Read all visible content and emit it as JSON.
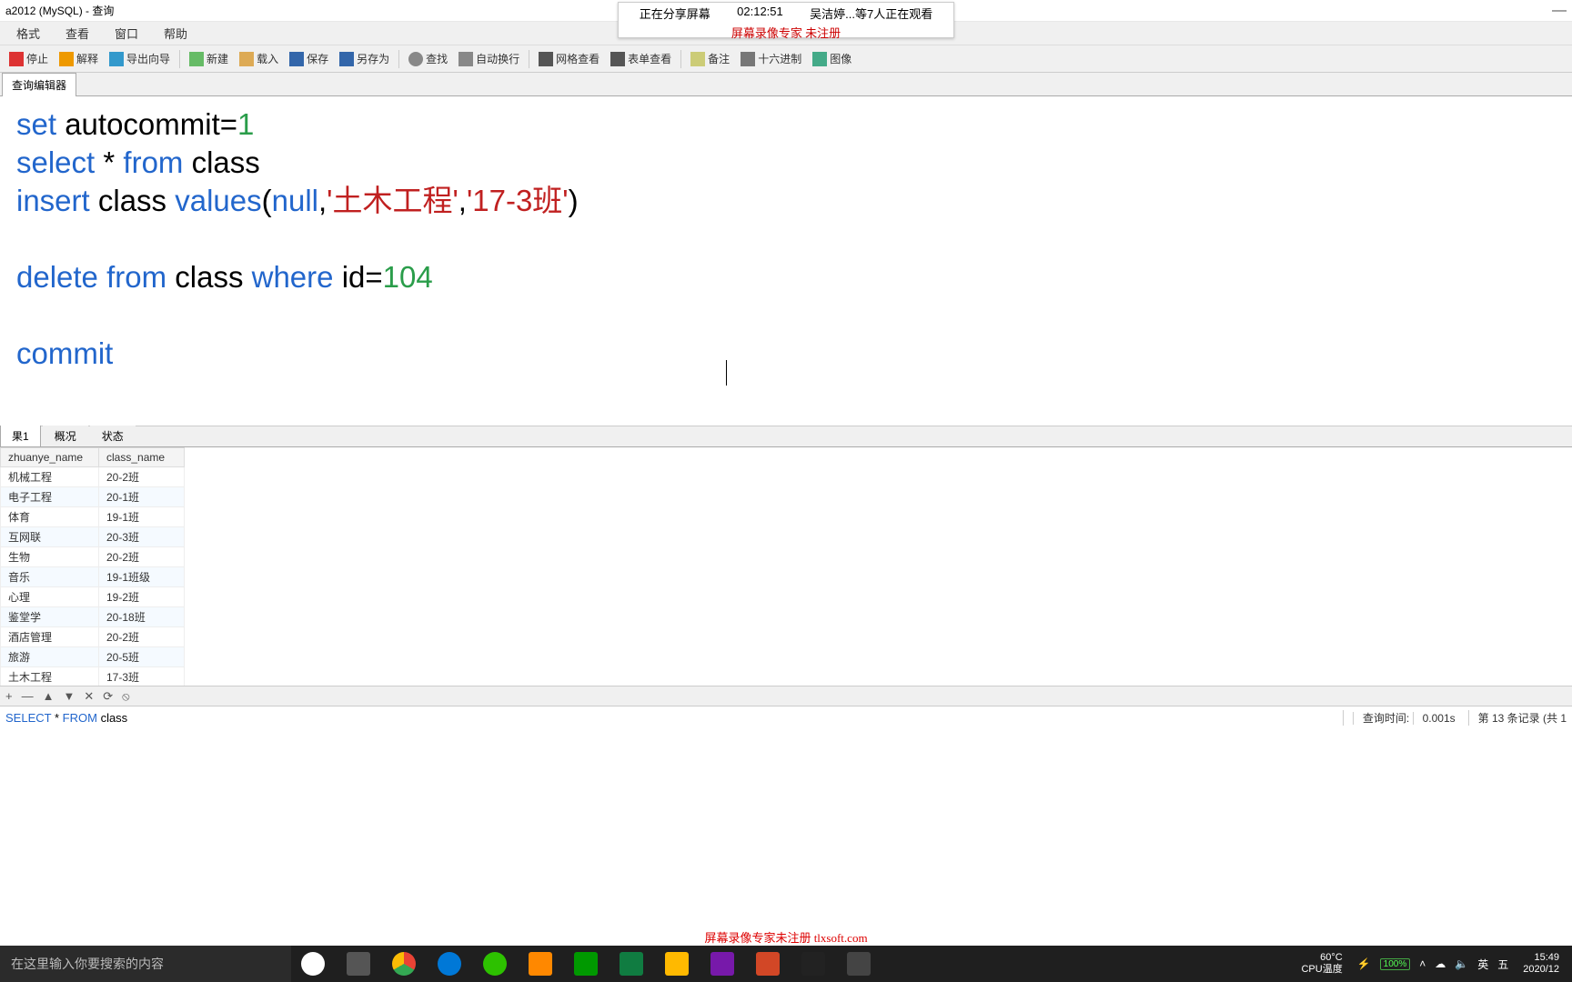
{
  "window": {
    "title": "a2012 (MySQL) - 查询"
  },
  "share_overlay": {
    "sharing_label": "正在分享屏幕",
    "timer": "02:12:51",
    "viewers": "吴洁婷...等7人正在观看",
    "watermark": "屏幕录像专家  未注册"
  },
  "menu": {
    "items": [
      "格式",
      "查看",
      "窗口",
      "帮助"
    ]
  },
  "toolbar": {
    "stop": "停止",
    "explain": "解释",
    "export_wizard": "导出向导",
    "new": "新建",
    "load": "载入",
    "save": "保存",
    "save_as": "另存为",
    "find": "查找",
    "auto_wrap": "自动换行",
    "grid_view": "网格查看",
    "form_view": "表单查看",
    "note": "备注",
    "hex": "十六进制",
    "image": "图像"
  },
  "tabs": {
    "editor_tab": "查询编辑器"
  },
  "sql_tokens": {
    "set": "set",
    "autocommit": "autocommit",
    "eq": "=",
    "one": "1",
    "select": "select",
    "star": "*",
    "from": "from",
    "class": "class",
    "insert": "insert",
    "values": "values",
    "lp": "(",
    "null": "null",
    "c1": ",",
    "s1": "'土木工程'",
    "c2": ",",
    "s2": "'17-3班'",
    "rp": ")",
    "delete": "delete",
    "where": "where",
    "id": "id",
    "n104": "104",
    "commit": "commit"
  },
  "result_tabs": {
    "r1": "果1",
    "profile": "概况",
    "status": "状态"
  },
  "grid": {
    "headers": {
      "col1": "zhuanye_name",
      "col2": "class_name"
    },
    "rows": [
      {
        "zhuanye_name": "机械工程",
        "class_name": "20-2班"
      },
      {
        "zhuanye_name": "电子工程",
        "class_name": "20-1班"
      },
      {
        "zhuanye_name": "体育",
        "class_name": "19-1班"
      },
      {
        "zhuanye_name": "互网联",
        "class_name": "20-3班"
      },
      {
        "zhuanye_name": "生物",
        "class_name": "20-2班"
      },
      {
        "zhuanye_name": "音乐",
        "class_name": "19-1班级"
      },
      {
        "zhuanye_name": "心理",
        "class_name": "19-2班"
      },
      {
        "zhuanye_name": "鉴堂学",
        "class_name": "20-18班"
      },
      {
        "zhuanye_name": "酒店管理",
        "class_name": "20-2班"
      },
      {
        "zhuanye_name": "旅游",
        "class_name": "20-5班"
      },
      {
        "zhuanye_name": "土木工程",
        "class_name": "17-3班"
      }
    ]
  },
  "grid_controls": {
    "symbols": [
      "+",
      "—",
      "▲",
      "▼",
      "✕",
      "⟳",
      "⦸"
    ]
  },
  "sql_preview": {
    "select": "SELECT",
    "star": "*",
    "from": "FROM",
    "table": "class",
    "query_time_label": "查询时间:",
    "query_time_value": "0.001s",
    "record_info": "第 13 条记录 (共 1"
  },
  "taskbar": {
    "search_placeholder": "在这里输入你要搜索的内容",
    "temp": "60°C",
    "temp_label": "CPU温度",
    "battery": "100%",
    "ime1": "英",
    "ime2": "五",
    "time": "15:49",
    "date": "2020/12"
  },
  "bottom_watermark": "屏幕录像专家未注册 tlxsoft.com"
}
